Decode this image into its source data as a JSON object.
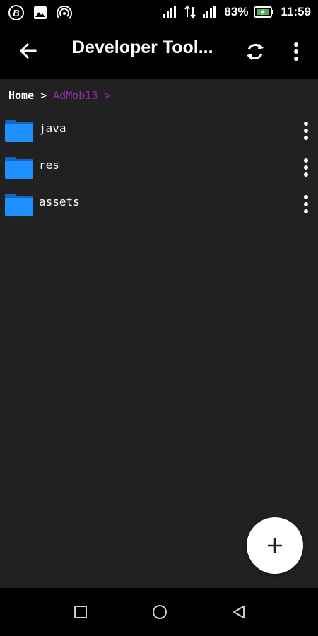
{
  "status_bar": {
    "left_icons": [
      "b-app-icon",
      "image-icon",
      "hotspot-icon"
    ],
    "right_icons": [
      "signal-icon",
      "data-icon",
      "signal-icon"
    ],
    "battery_percent": "83%",
    "time": "11:59"
  },
  "toolbar": {
    "title": "Developer Tool...",
    "icons": [
      "back-arrow-icon",
      "refresh-icon",
      "overflow-menu-icon"
    ]
  },
  "breadcrumb": {
    "home": "Home",
    "separator": ">",
    "current": "AdMob13",
    "trailing": ">"
  },
  "files": [
    {
      "name": "java",
      "icon": "folder-icon"
    },
    {
      "name": "res",
      "icon": "folder-icon"
    },
    {
      "name": "assets",
      "icon": "folder-icon"
    }
  ],
  "fab": {
    "icon": "plus-icon"
  },
  "nav_bar": {
    "icons": [
      "recents-square-icon",
      "home-circle-icon",
      "back-triangle-icon"
    ]
  },
  "colors": {
    "accent": "#9c27b0",
    "folder": "#1e90ff",
    "background": "#212121"
  }
}
